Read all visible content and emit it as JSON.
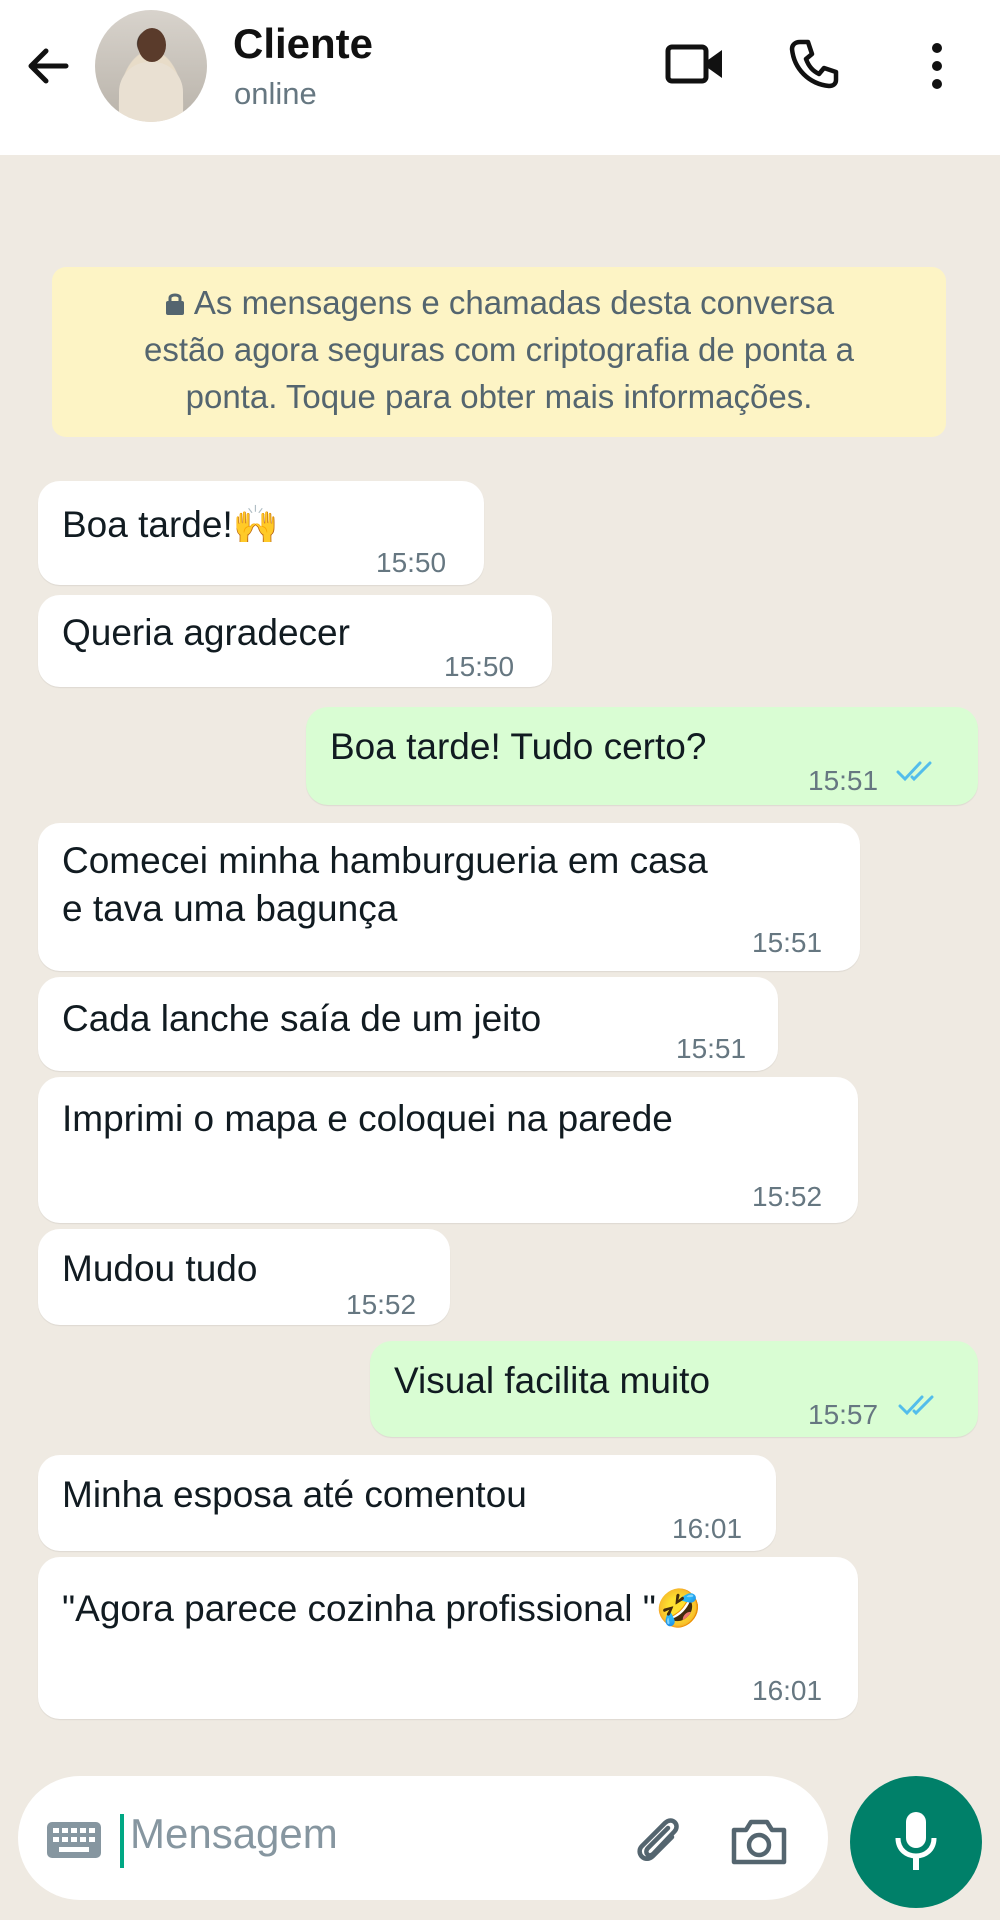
{
  "header": {
    "contact_name": "Cliente",
    "status": "online",
    "icons": [
      "back-arrow-icon",
      "avatar",
      "video-call-icon",
      "phone-call-icon",
      "more-menu-icon"
    ]
  },
  "notice": {
    "line1": "As mensagens e chamadas desta conversa",
    "line2": "estão agora seguras com criptografia de ponta a",
    "line3": "ponta. Toque para obter mais informações."
  },
  "messages": [
    {
      "direction": "in",
      "text": "Boa tarde!🙌",
      "time": "15:50"
    },
    {
      "direction": "in",
      "text": "Queria agradecer",
      "time": "15:50"
    },
    {
      "direction": "out",
      "text": "Boa tarde! Tudo certo?",
      "time": "15:51",
      "status": "read"
    },
    {
      "direction": "in",
      "text_line1": "Comecei minha hamburgueria em casa",
      "text_line2": "e tava uma bagunça",
      "time": "15:51"
    },
    {
      "direction": "in",
      "text": "Cada lanche saía de um jeito",
      "time": "15:51"
    },
    {
      "direction": "in",
      "text": "Imprimi o mapa e coloquei na parede",
      "time": "15:52"
    },
    {
      "direction": "in",
      "text": "Mudou tudo",
      "time": "15:52"
    },
    {
      "direction": "out",
      "text": "Visual facilita muito",
      "time": "15:57",
      "status": "read"
    },
    {
      "direction": "in",
      "text": "Minha esposa até comentou",
      "time": "16:01"
    },
    {
      "direction": "in",
      "text": "\"Agora parece cozinha profissional \"🤣",
      "time": "16:01"
    }
  ],
  "composer": {
    "placeholder": "Mensagem",
    "icons": [
      "keyboard-icon",
      "attach-icon",
      "camera-icon",
      "mic-icon"
    ]
  },
  "colors": {
    "chat_background": "#efeae2",
    "incoming_bubble": "#ffffff",
    "outgoing_bubble": "#d9fdd3",
    "notice_background": "#fdf4c5",
    "read_ticks": "#53bdeb",
    "accent": "#008069"
  }
}
